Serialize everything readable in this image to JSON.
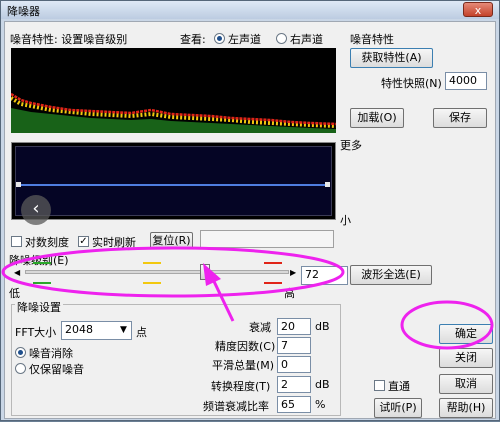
{
  "window": {
    "title": "降噪器",
    "close_label": "x"
  },
  "noise_profile": {
    "header": "噪音特性: 设置噪音级别",
    "view_label": "查看:",
    "left_channel": "左声道",
    "right_channel": "右声道",
    "selected_channel": "左声道"
  },
  "right_panel": {
    "group_title": "噪音特性",
    "get_profile_button": "获取特性(A)",
    "snapshot_label": "特性快照(N)",
    "snapshot_value": "4000",
    "load_button": "加载(O)",
    "save_button": "保存"
  },
  "envelope": {
    "more_label": "更多",
    "less_label": "小"
  },
  "options": {
    "log_scale_label": "对数刻度",
    "log_scale_checked": false,
    "live_update_label": "实时刷新",
    "live_update_checked": true,
    "reset_button": "复位(R)"
  },
  "level": {
    "label": "降噪级别(E)",
    "value": "72",
    "low_label": "低",
    "high_label": "高",
    "select_all_button": "波形全选(E)"
  },
  "settings": {
    "group_title": "降噪设置",
    "fft_label": "FFT大小",
    "fft_value": "2048",
    "fft_unit": "点",
    "remove_noise_label": "噪音消除",
    "keep_noise_label": "仅保留噪音",
    "selected_mode": "噪音消除",
    "attenuation_label": "衰减",
    "attenuation_value": "20",
    "attenuation_unit": "dB",
    "precision_label": "精度因数(C)",
    "precision_value": "7",
    "smoothing_label": "平滑总量(M)",
    "smoothing_value": "0",
    "transition_label": "转换程度(T)",
    "transition_value": "2",
    "transition_unit": "dB",
    "spectral_label": "频谱衰减比率",
    "spectral_value": "65",
    "spectral_unit": "%"
  },
  "actions": {
    "ok_button": "确定",
    "close_button": "关闭",
    "bypass_label": "直通",
    "cancel_button": "取消",
    "preview_button": "试听(P)",
    "help_button": "帮助(H)"
  },
  "colors": {
    "annotation": "#ee22ee",
    "spectrum_red": "#e02418",
    "spectrum_yellow": "#f2c80f",
    "spectrum_green": "#2aa82a",
    "envelope_line": "#4f7de0"
  }
}
